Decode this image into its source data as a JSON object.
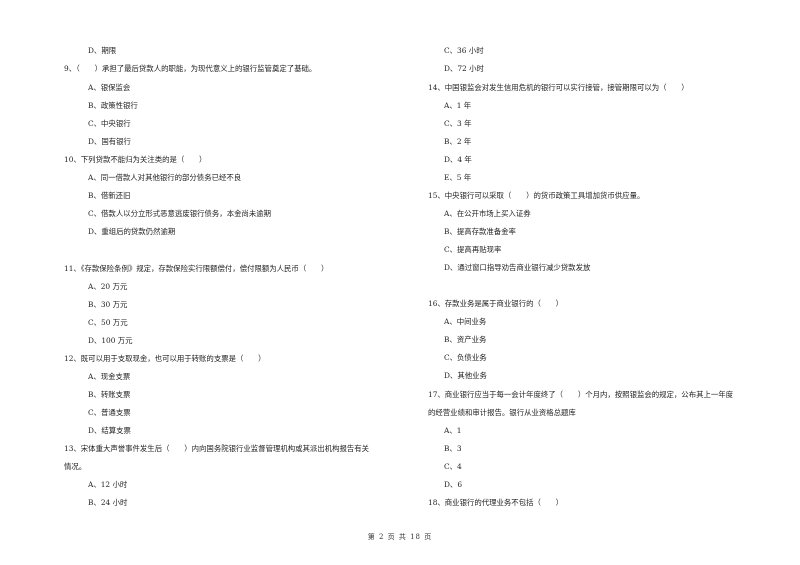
{
  "left_column": {
    "q8_tail": {
      "options": [
        "D、期限"
      ]
    },
    "q9": {
      "text": "9、（　　）承担了最后贷款人的职能，为现代意义上的银行监管奠定了基础。",
      "options": [
        "A、银保监会",
        "B、政策性银行",
        "C、中央银行",
        "D、国有银行"
      ]
    },
    "q10": {
      "text": "10、下列贷款不能归为关注类的是（　　）",
      "options": [
        "A、同一借款人对其他银行的部分债务已经不良",
        "B、借新还旧",
        "C、借款人以分立形式恶意逃废银行债务，本金尚未逾期",
        "D、重组后的贷款仍然逾期"
      ]
    },
    "q11": {
      "text": "11、《存款保险条例》规定，存款保险实行限额偿付，偿付限额为人民币（　　）",
      "options": [
        "A、20 万元",
        "B、30 万元",
        "C、50 万元",
        "D、100 万元"
      ]
    },
    "q12": {
      "text": "12、既可以用于支取现金，也可以用于转账的支票是（　　）",
      "options": [
        "A、现金支票",
        "B、转账支票",
        "C、普通支票",
        "D、结算支票"
      ]
    },
    "q13": {
      "text_line1": "13、宋体重大声誉事件发生后（　　）内向国务院银行业监督管理机构或其派出机构报告有关",
      "text_line2": "情况。",
      "options": [
        "A、12 小时",
        "B、24 小时"
      ]
    }
  },
  "right_column": {
    "q13_tail": {
      "options": [
        "C、36 小时",
        "D、72 小时"
      ]
    },
    "q14": {
      "text": "14、中国银监会对发生信用危机的银行可以实行接管，接管期限可以为（　　）",
      "options": [
        "A、1 年",
        "C、3 年",
        "B、2 年",
        "D、4 年",
        "E、5 年"
      ]
    },
    "q15": {
      "text": "15、中央银行可以采取（　　）的货币政策工具增加货币供应量。",
      "options": [
        "A、在公开市场上买入证券",
        "B、提高存款准备金率",
        "C、提高再贴现率",
        "D、通过窗口指导劝告商业银行减少贷款发放"
      ]
    },
    "q16": {
      "text": "16、存款业务是属于商业银行的（　　）",
      "options": [
        "A、中间业务",
        "B、资产业务",
        "C、负债业务",
        "D、其他业务"
      ]
    },
    "q17": {
      "text_line1": "17、商业银行应当于每一会计年度终了（　　）个月内，按照银监会的规定，公布其上一年度",
      "text_line2": "的经营业绩和审计报告。银行从业资格总题库",
      "options": [
        "A、1",
        "B、3",
        "C、4",
        "D、6"
      ]
    },
    "q18": {
      "text": "18、商业银行的代理业务不包括（　　）"
    }
  },
  "footer": {
    "page_label": "第 2 页 共 18 页"
  }
}
